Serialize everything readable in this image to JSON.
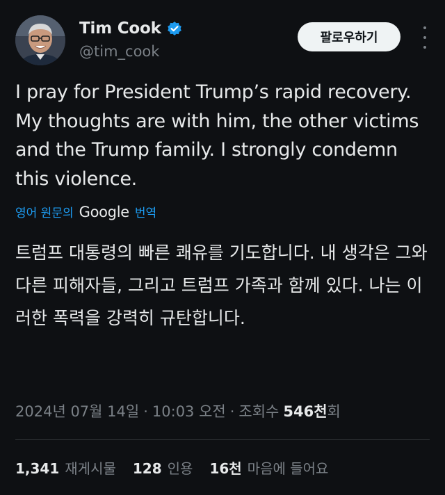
{
  "author": {
    "display_name": "Tim Cook",
    "handle": "@tim_cook",
    "verified": true
  },
  "follow_button_label": "팔로우하기",
  "tweet_text": "I pray for President Trump’s rapid recovery.  My thoughts are with him, the other victims and the Trump family. I strongly condemn this violence.",
  "translation": {
    "prefix": "영어 원문의",
    "provider": "Google",
    "suffix": "번역",
    "translated_text": "트럼프 대통령의 빠른 쾌유를 기도합니다. 내 생각은 그와 다른 피해자들, 그리고 트럼프 가족과 함께 있다. 나는 이러한 폭력을 강력히 규탄합니다."
  },
  "meta": {
    "date": "2024년 07월 14일",
    "time": "10:03 오전",
    "separator": "·",
    "views_label": "조회수",
    "views_count": "546천",
    "views_suffix": "회"
  },
  "stats": {
    "reposts_count": "1,341",
    "reposts_label": "재게시물",
    "quotes_count": "128",
    "quotes_label": "인용",
    "likes_count": "16천",
    "likes_label": "마음에 들어요"
  },
  "colors": {
    "background": "#0e1013",
    "text_primary": "#e7e9ea",
    "text_secondary": "#7b8187",
    "accent": "#1d9bf0",
    "button_bg": "#eff3f4"
  },
  "icons": {
    "verified": "verified-badge-icon",
    "more": "more-options-icon"
  }
}
